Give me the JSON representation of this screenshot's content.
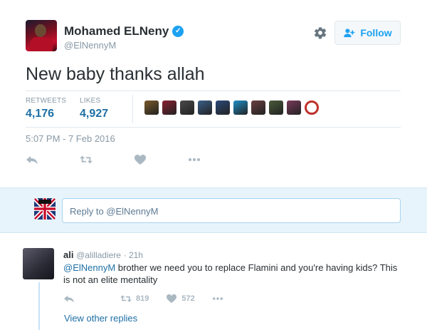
{
  "author": {
    "name": "Mohamed ELNeny",
    "handle": "@ElNennyM",
    "verified_mark": "✓"
  },
  "header": {
    "follow_label": "Follow",
    "settings_icon": "gear-icon"
  },
  "tweet": {
    "text": "New baby thanks allah",
    "timestamp": "5:07 PM - 7 Feb 2016"
  },
  "stats": {
    "retweets_label": "RETWEETS",
    "retweets_count": "4,176",
    "likes_label": "LIKES",
    "likes_count": "4,927"
  },
  "likers_colors": [
    "#7a5a2a",
    "#8a2030",
    "#4a4a4a",
    "#3b5f8a",
    "#2a4a7a",
    "#1e90c8",
    "#6a4040",
    "#4a5a3a",
    "#7a3a5a",
    "#c0302a"
  ],
  "reply_box": {
    "placeholder": "Reply to @ElNennyM"
  },
  "reply": {
    "name": "ali",
    "handle": "@alilladiere",
    "time": "· 21h",
    "mention": "@ElNennyM",
    "text": " brother we need you to replace Flamini and you're having kids? This is not an elite mentality",
    "retweets": "819",
    "likes": "572",
    "view_replies": "View other replies"
  },
  "colors": {
    "accent": "#1da1f2",
    "link": "#1d6fa5",
    "muted": "#8899a6"
  }
}
